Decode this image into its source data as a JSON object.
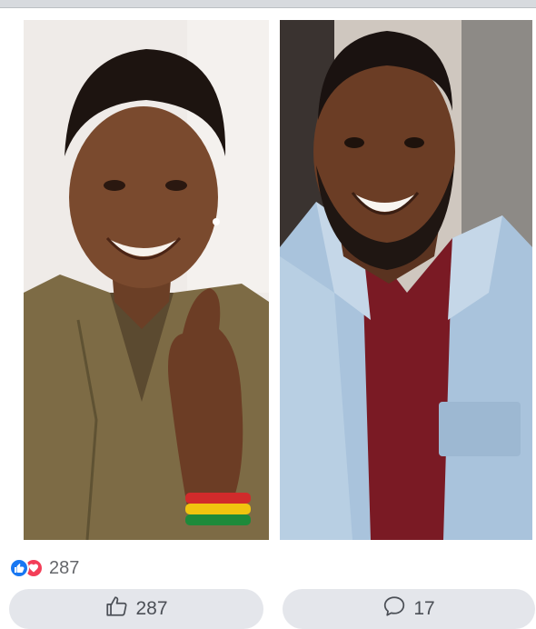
{
  "post": {
    "reaction_total": "287",
    "like_count": "287",
    "comment_count": "17"
  },
  "colors": {
    "like_blue": "#1877f2",
    "love_red": "#f33e58",
    "button_bg": "#e4e6eb",
    "count_text": "#65676b"
  },
  "icons": {
    "reaction_like": "thumbs-up-icon",
    "reaction_love": "heart-icon",
    "like_button": "thumbs-up-outline-icon",
    "comment_button": "comment-bubble-icon"
  }
}
